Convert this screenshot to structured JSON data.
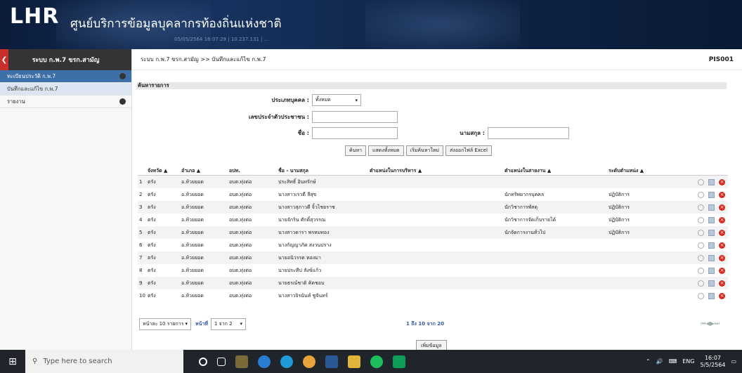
{
  "header": {
    "logo": "LHR",
    "title": "ศูนย์บริการข้อมูลบุคลากรท้องถิ่นแห่งชาติ",
    "subtitle": "05/05/2564 16:07:29 | 10.237.131 | ..."
  },
  "sidebar": {
    "heading": "ระบบ ก.พ.7 ขรก.สามัญ",
    "back_icon": "chevron-left-icon",
    "items": [
      {
        "label": "ทะเบียนประวัติ ก.พ.7"
      },
      {
        "label": "บันทึกและแก้ไข ก.พ.7"
      },
      {
        "label": "รายงาน"
      }
    ]
  },
  "topbar": {
    "breadcrumb": "ระบบ ก.พ.7 ขรก.สามัญ >> บันทึกและแก้ไข ก.พ.7",
    "code": "PIS001"
  },
  "search": {
    "title": "ค้นหารายการ",
    "person_type_label": "ประเภทบุคคล :",
    "person_type_value": "ทั้งหมด",
    "id_label": "เลขประจำตัวประชาชน :",
    "name_label": "ชื่อ :",
    "surname_label": "นามสกุล :",
    "buttons": {
      "search": "ค้นหา",
      "show_all": "แสดงทั้งหมด",
      "reset": "เริ่มค้นหาใหม่",
      "export": "ส่งออกไฟล์ Excel"
    }
  },
  "table": {
    "headers": [
      "จังหวัด ▲",
      "อำเภอ ▲",
      "อปท.",
      "ชื่อ - นามสกุล",
      "ตำแหน่งในการบริหาร ▲",
      "ตำแหน่งในสายงาน ▲",
      "ระดับตำแหน่ง ▲"
    ],
    "rows": [
      {
        "no": "1",
        "province": "ตรัง",
        "district": "อ.ห้วยยอด",
        "org": "อบต.ทุ่งต่อ",
        "name": "ประสิทธิ์ อินทรักษ์",
        "admin_pos": "",
        "line_pos": "",
        "level": ""
      },
      {
        "no": "2",
        "province": "ตรัง",
        "district": "อ.ห้วยยอด",
        "org": "อบต.ทุ่งต่อ",
        "name": "นางสาวเรวดี ลีสุข",
        "admin_pos": "",
        "line_pos": "นักทรัพยากรบุคคล",
        "level": "ปฏิบัติการ"
      },
      {
        "no": "3",
        "province": "ตรัง",
        "district": "อ.ห้วยยอด",
        "org": "อบต.ทุ่งต่อ",
        "name": "นางสาวสุภาวดี จิ้วไชยราช",
        "admin_pos": "",
        "line_pos": "นักวิชาการพัสดุ",
        "level": "ปฏิบัติการ"
      },
      {
        "no": "4",
        "province": "ตรัง",
        "district": "อ.ห้วยยอด",
        "org": "อบต.ทุ่งต่อ",
        "name": "นายจักริน ศักดิ์สุวรรณ",
        "admin_pos": "",
        "line_pos": "นักวิชาการจัดเก็บรายได้",
        "level": "ปฏิบัติการ"
      },
      {
        "no": "5",
        "province": "ตรัง",
        "district": "อ.ห้วยยอด",
        "org": "อบต.ทุ่งต่อ",
        "name": "นางสาวดารา พรหมทอง",
        "admin_pos": "",
        "line_pos": "นักจัดการงานทั่วไป",
        "level": "ปฏิบัติการ"
      },
      {
        "no": "6",
        "province": "ตรัง",
        "district": "อ.ห้วยยอด",
        "org": "อบต.ทุ่งต่อ",
        "name": "นางกัญญาภัค สงวนปราง",
        "admin_pos": "",
        "line_pos": "",
        "level": ""
      },
      {
        "no": "7",
        "province": "ตรัง",
        "district": "อ.ห้วยยอด",
        "org": "อบต.ทุ่งต่อ",
        "name": "นายอนิวรรต ทองมา",
        "admin_pos": "",
        "line_pos": "",
        "level": ""
      },
      {
        "no": "8",
        "province": "ตรัง",
        "district": "อ.ห้วยยอด",
        "org": "อบต.ทุ่งต่อ",
        "name": "นายประทีป สังข์แก้ว",
        "admin_pos": "",
        "line_pos": "",
        "level": ""
      },
      {
        "no": "9",
        "province": "ตรัง",
        "district": "อ.ห้วยยอด",
        "org": "อบต.ทุ่งต่อ",
        "name": "นายธรณ์ชาติ คิดชอบ",
        "admin_pos": "",
        "line_pos": "",
        "level": ""
      },
      {
        "no": "10",
        "province": "ตรัง",
        "district": "อ.ห้วยยอด",
        "org": "อบต.ทุ่งต่อ",
        "name": "นางสาวจิรนันท์ ชูจันทร์",
        "admin_pos": "",
        "line_pos": "",
        "level": ""
      }
    ]
  },
  "pager": {
    "per_page": "หน้าละ 10 รายการ",
    "page_label": "หน้าที่",
    "page_value": "1 จาก 2",
    "summary": "1 ถึง 10 จาก 20",
    "nav": "⏮◀▶⏭"
  },
  "add_button": "เพิ่มข้อมูล",
  "taskbar": {
    "search_placeholder": "Type here to search",
    "lang": "ENG",
    "time": "16:07",
    "date": "5/5/2564"
  }
}
